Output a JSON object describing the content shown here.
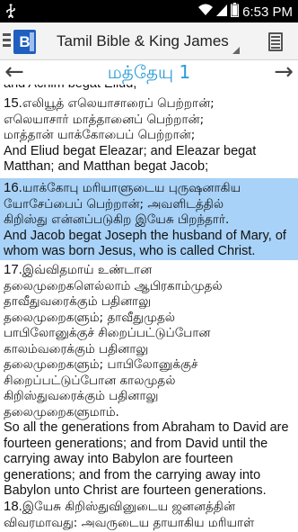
{
  "status_bar": {
    "usb_icon": "usb-icon",
    "wifi_icon": "wifi-icon",
    "signal_icon": "signal-icon",
    "battery_icon": "battery-icon",
    "time": "6:53 PM"
  },
  "action_bar": {
    "title": "Tamil Bible & King James",
    "menu_icon": "hamburger-icon",
    "app_icon_letter": "B",
    "list_icon": "list-icon"
  },
  "nav": {
    "prev_arrow": "←",
    "chapter": "மத்தேயு 1",
    "next_arrow": "→"
  },
  "content": {
    "top_partial": "and Achim begat Eliud;",
    "verses": [
      {
        "number": "15.",
        "tamil": [
          "எலியூத் எலெயாசாரைப் பெற்றான்;",
          "எலெயாசார் மாத்தானைப் பெற்றான்;",
          "மாத்தான் யாக்கோபைப் பெற்றான்;"
        ],
        "english": [
          "And Eliud begat Eleazar; and Eleazar begat",
          "Matthan; and Matthan begat Jacob;"
        ]
      },
      {
        "number": "16.",
        "tamil": [
          "யாக்கோபு மரியாளுடைய புருஷனாகிய",
          "யோசேப்பைப் பெற்றான்; அவளிடத்தில்",
          "கிறிஸ்து என்னப்படுகிற இயேசு பிறந்தார்."
        ],
        "english": [
          "And Jacob begat Joseph the husband of Mary, of",
          "whom was born Jesus, who is called Christ."
        ]
      },
      {
        "number": "17.",
        "tamil": [
          "இவ்விதமாய் உண்டான",
          "தலைமுறைகளெல்லாம் ஆபிரகாம்முதல்",
          "தாவீதுவரைக்கும் பதினாலு",
          "தலைமுறைகளும்; தாவீதுமுதல்",
          "பாபிலோனுக்குச் சிறைப்பட்டுப்போன",
          "காலம்வரைக்கும் பதினாலு",
          "தலைமுறைகளும்; பாபிலோனுக்குச்",
          "சிறைப்பட்டுப்போன காலமுதல்",
          "கிறிஸ்துவரைக்கும் பதினாலு",
          "தலைமுறைகளுமாம்."
        ],
        "english": [
          "So all the generations from Abraham to David are",
          "fourteen generations; and from David until the",
          "carrying away into Babylon are fourteen",
          "generations; and from the carrying away into",
          "Babylon unto Christ are fourteen generations."
        ]
      },
      {
        "number": "18.",
        "tamil": [
          "இயேசு கிறிஸ்துவினுடைய ஜனனத்தின்",
          "விவரமாவது: அவருடைய தாயாகிய மரியாள்"
        ],
        "english": []
      }
    ]
  }
}
